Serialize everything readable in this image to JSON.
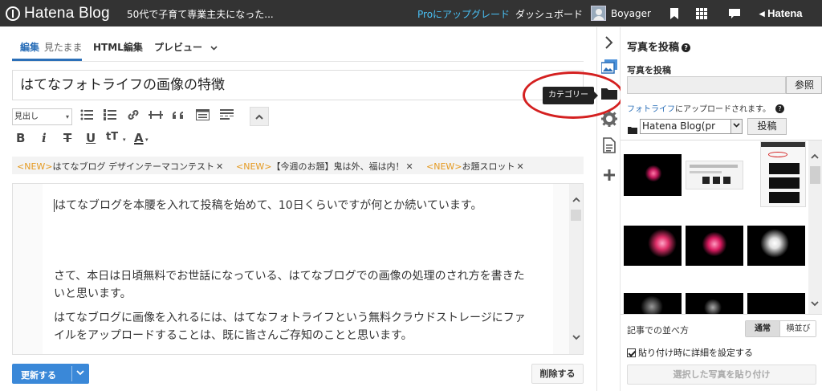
{
  "topbar": {
    "brand": "Hatena Blog",
    "blog_title": "50代で子育て専業主夫になった...",
    "pro_accent": "Pro",
    "pro_rest": "にアップグレード",
    "dashboard": "ダッシュボード",
    "username": "Boyager",
    "hatena": "Hatena",
    "icons": [
      "bookmark-icon",
      "grid-icon",
      "chat-icon",
      "hatena-logo-icon"
    ]
  },
  "tabs": {
    "edit_main": "編集",
    "edit_sub": "見たまま",
    "html": "HTML編集",
    "preview": "プレビュー"
  },
  "title_input": "はてなフォトライフの画像の特徴",
  "toolbar": {
    "heading_select": "見出し",
    "icons": [
      "bulleted-list-icon",
      "numbered-list-icon",
      "link-icon",
      "horizontal-rule-icon",
      "quote-icon",
      "table-icon",
      "more-icon",
      "collapse-icon"
    ],
    "format_buttons": [
      "B",
      "i",
      "T",
      "U",
      "tT",
      "A"
    ]
  },
  "notices": [
    {
      "tag": "<NEW>",
      "text": "はてなブログ デザインテーマコンテスト"
    },
    {
      "tag": "<NEW>",
      "text": "【今週のお題】鬼は外、福は内！"
    },
    {
      "tag": "<NEW>",
      "text": "お題スロット"
    }
  ],
  "editor": {
    "para1": "はてなブログを本腰を入れて投稿を始めて、10日くらいですが何とか続いています。",
    "para2": "さて、本日は日頃無料でお世話になっている、はてなブログでの画像の処理のされ方を書きたいと思います。",
    "para3": "はてなブログに画像を入れるには、はてなフォトライフという無料クラウドストレージにファイルをアップロードすることは、既に皆さんご存知のことと思います。"
  },
  "buttons": {
    "update": "更新する",
    "delete": "削除する"
  },
  "iconstrip": [
    "chevron-right-icon",
    "image-icon",
    "folder-icon",
    "gear-icon",
    "document-icon",
    "plus-icon"
  ],
  "tooltip": "カテゴリー",
  "panel": {
    "title": "写真を投稿",
    "upload_label": "写真を投稿",
    "browse": "参照",
    "note_link": "フォトライフ",
    "note_rest": "にアップロードされます。",
    "folder_value": "Hatena Blog(pr",
    "post_button": "投稿",
    "sort_label": "記事での並べ方",
    "sort_normal": "通常",
    "sort_side": "横並び",
    "detail_label": "貼り付け時に詳細を設定する",
    "detail_checked": true,
    "paste_button": "選択した写真を貼り付け"
  },
  "colors": {
    "topbar": "#333333",
    "accent_blue": "#2b6fb8",
    "pro_link": "#49c1f6",
    "new_tag": "#e59a21",
    "update_button": "#3a88d8",
    "annotation_red": "#d42020"
  }
}
